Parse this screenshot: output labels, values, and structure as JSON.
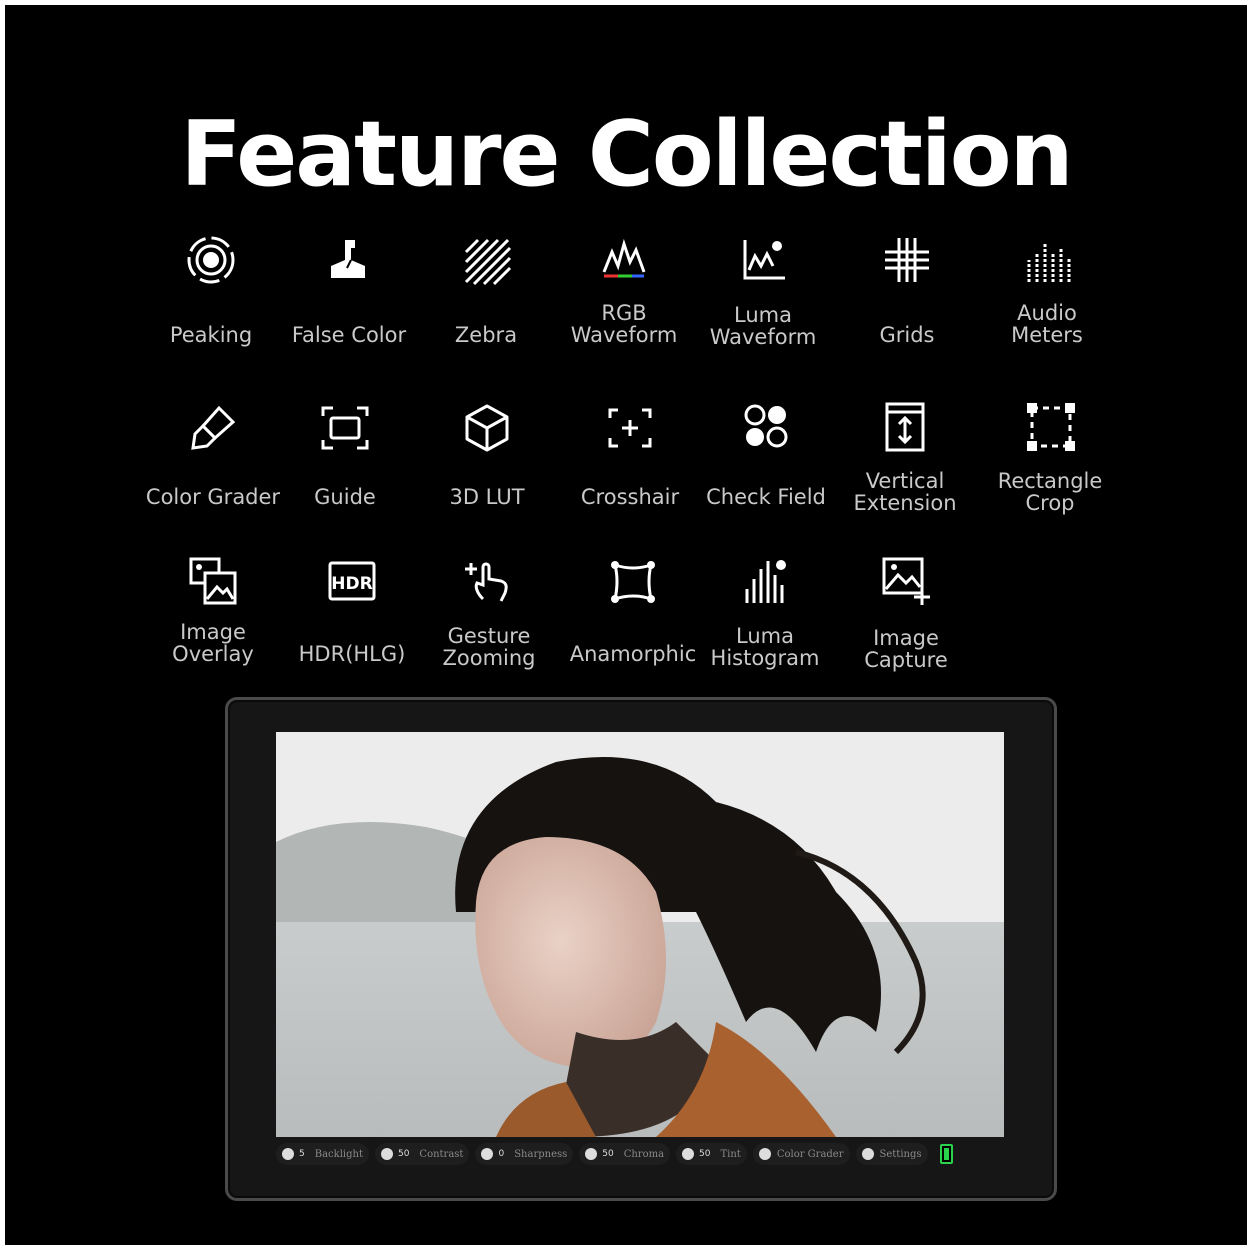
{
  "title": "Feature Collection",
  "features": [
    {
      "label": "Peaking",
      "icon": "peaking-icon"
    },
    {
      "label": "False Color",
      "icon": "false-color-icon"
    },
    {
      "label": "Zebra",
      "icon": "zebra-icon"
    },
    {
      "label": "RGB\nWaveform",
      "icon": "rgb-waveform-icon"
    },
    {
      "label": "Luma\nWaveform",
      "icon": "luma-waveform-icon"
    },
    {
      "label": "Grids",
      "icon": "grids-icon"
    },
    {
      "label": "Audio\nMeters",
      "icon": "audio-meters-icon"
    },
    {
      "label": "Color Grader",
      "icon": "color-grader-icon"
    },
    {
      "label": "Guide",
      "icon": "guide-icon"
    },
    {
      "label": "3D LUT",
      "icon": "3d-lut-icon"
    },
    {
      "label": "Crosshair",
      "icon": "crosshair-icon"
    },
    {
      "label": "Check Field",
      "icon": "check-field-icon"
    },
    {
      "label": "Vertical\nExtension",
      "icon": "vertical-extension-icon"
    },
    {
      "label": "Rectangle\nCrop",
      "icon": "rectangle-crop-icon"
    },
    {
      "label": "Image\nOverlay",
      "icon": "image-overlay-icon"
    },
    {
      "label": "HDR(HLG)",
      "icon": "hdr-icon"
    },
    {
      "label": "Gesture\nZooming",
      "icon": "gesture-zooming-icon"
    },
    {
      "label": "Anamorphic",
      "icon": "anamorphic-icon"
    },
    {
      "label": "Luma\nHistogram",
      "icon": "luma-histogram-icon"
    },
    {
      "label": "Image\nCapture",
      "icon": "image-capture-icon"
    }
  ],
  "statusbar": {
    "backlight": {
      "value": "5",
      "label": "Backlight"
    },
    "contrast": {
      "value": "50",
      "label": "Contrast"
    },
    "sharpness": {
      "value": "0",
      "label": "Sharpness"
    },
    "chroma": {
      "value": "50",
      "label": "Chroma"
    },
    "tint": {
      "value": "50",
      "label": "Tint"
    },
    "color_grader": {
      "label": "Color Grader"
    },
    "settings": {
      "label": "Settings"
    }
  }
}
